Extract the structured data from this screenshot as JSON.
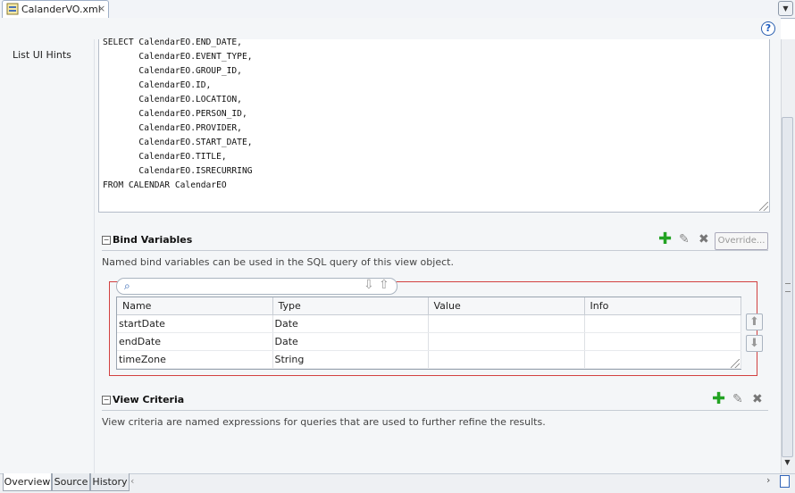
{
  "editor_tab": {
    "title": "CalanderVO.xml",
    "close": "×",
    "menu_glyph": "▼"
  },
  "help_button": {
    "label": "?"
  },
  "left_nav": {
    "items": [
      {
        "label": "List UI Hints"
      }
    ]
  },
  "sql_query": {
    "text": "SELECT CalendarEO.END_DATE,\n       CalendarEO.EVENT_TYPE,\n       CalendarEO.GROUP_ID,\n       CalendarEO.ID,\n       CalendarEO.LOCATION,\n       CalendarEO.PERSON_ID,\n       CalendarEO.PROVIDER,\n       CalendarEO.START_DATE,\n       CalendarEO.TITLE,\n       CalendarEO.ISRECURRING\nFROM CALENDAR CalendarEO"
  },
  "bind_variables": {
    "toggle": "−",
    "title": "Bind Variables",
    "description": "Named bind variables can be used in the SQL query of this view object.",
    "override_label": "Override...",
    "columns": [
      "Name",
      "Type",
      "Value",
      "Info"
    ],
    "rows": [
      {
        "name": "startDate",
        "type": "Date",
        "value": "",
        "info": ""
      },
      {
        "name": "endDate",
        "type": "Date",
        "value": "",
        "info": ""
      },
      {
        "name": "timeZone",
        "type": "String",
        "value": "",
        "info": ""
      }
    ]
  },
  "view_criteria": {
    "toggle": "−",
    "title": "View Criteria",
    "description": "View criteria are named expressions for queries that are used to further refine the results."
  },
  "icons": {
    "add": "✚",
    "edit": "✎",
    "delete": "✖",
    "filter": "⌕",
    "move_down": "⇩",
    "move_up": "⇧",
    "arrow_up": "⬆",
    "arrow_down": "⬇",
    "scroll_left": "‹",
    "scroll_right": "›",
    "scroll_down": "▼"
  },
  "bottom_tabs": [
    {
      "label": "Overview"
    },
    {
      "label": "Source"
    },
    {
      "label": "History"
    }
  ],
  "colors": {
    "accent": "#2a5fb0",
    "add_green": "#23a323",
    "highlight_red": "#d24040"
  }
}
